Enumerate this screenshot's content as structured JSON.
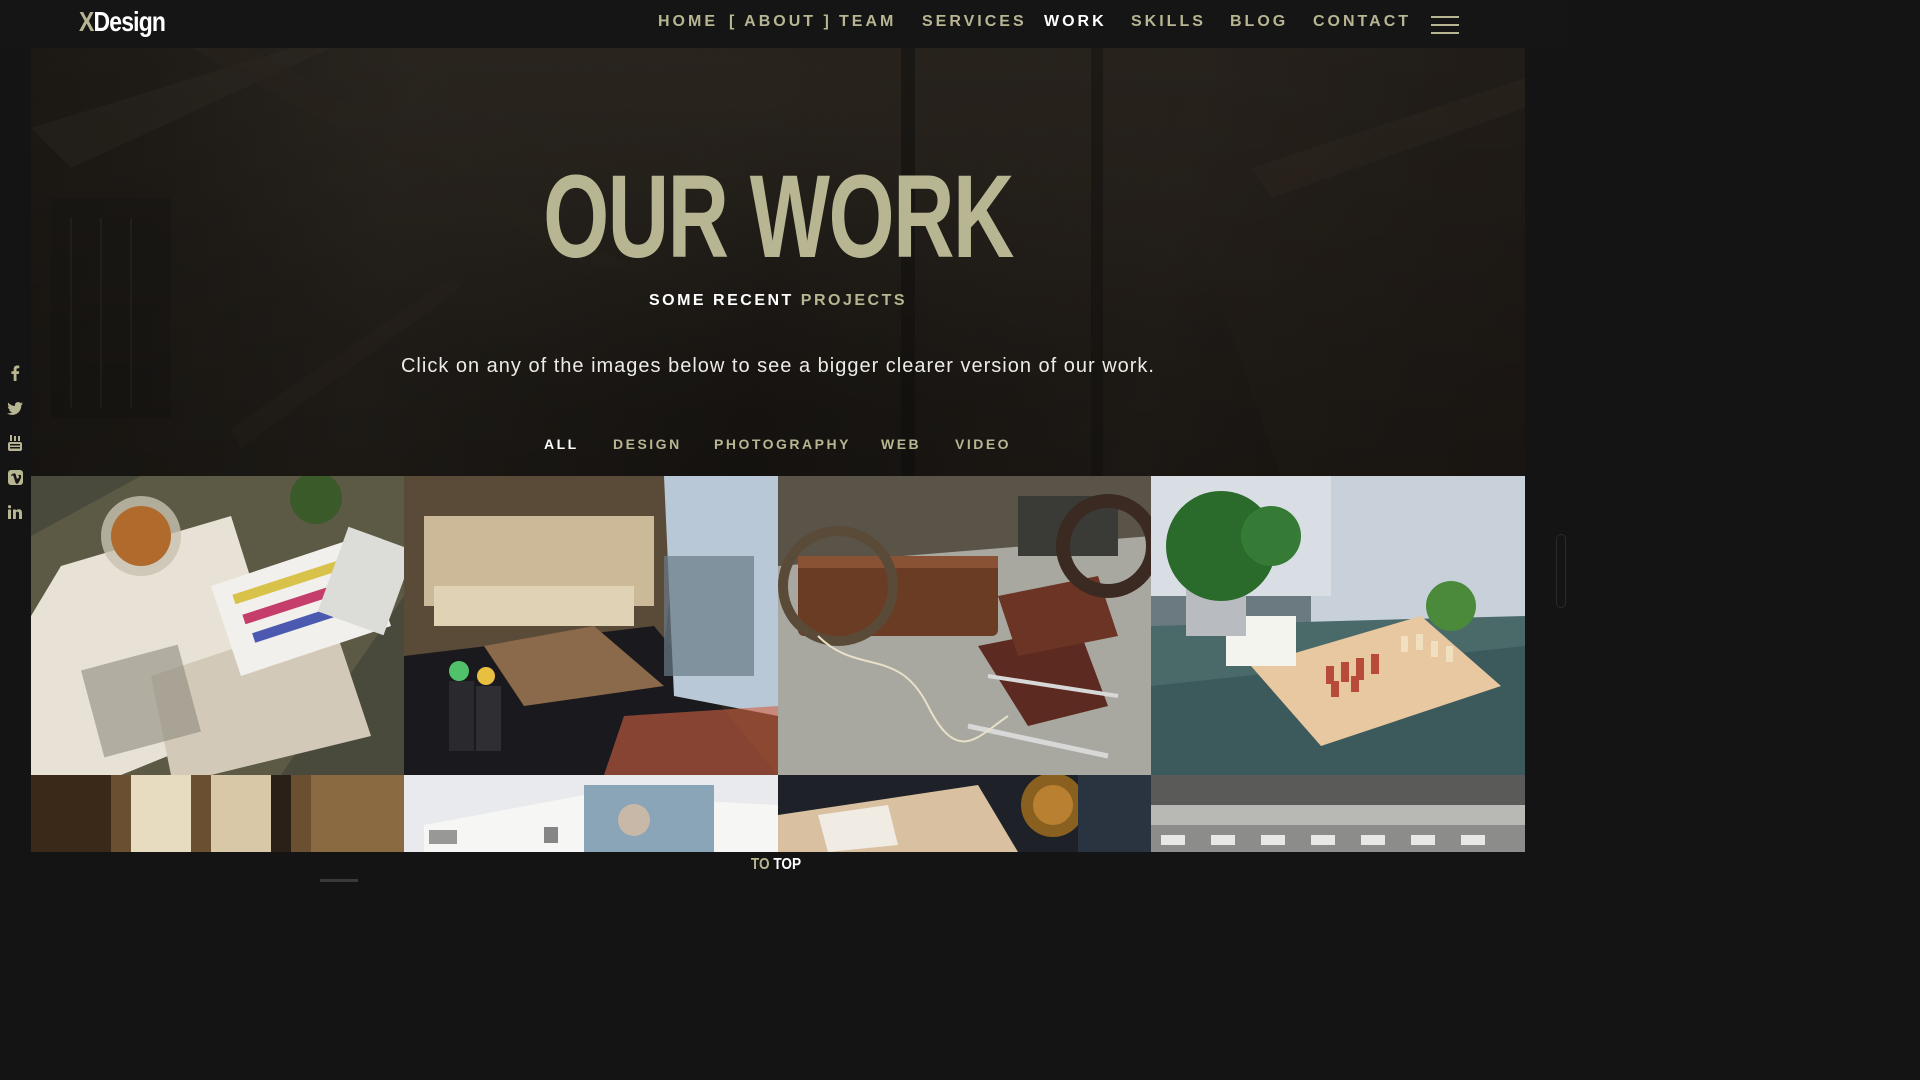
{
  "brand": {
    "logo_x": "X",
    "logo_rest": "Design"
  },
  "nav": {
    "items": [
      {
        "label": "HOME"
      },
      {
        "label": "[ ABOUT ]"
      },
      {
        "label": "TEAM"
      },
      {
        "label": "SERVICES"
      },
      {
        "label": "WORK"
      },
      {
        "label": "SKILLS"
      },
      {
        "label": "BLOG"
      },
      {
        "label": "CONTACT"
      }
    ],
    "active": "WORK",
    "menu_icon": "hamburger-icon"
  },
  "hero": {
    "title": "OUR WORK",
    "subtitle_a": "SOME RECENT",
    "subtitle_b": "PROJECTS",
    "description": "Click on any of the images below to see a bigger clearer version of our work."
  },
  "filters": {
    "items": [
      {
        "label": "ALL"
      },
      {
        "label": "DESIGN"
      },
      {
        "label": "PHOTOGRAPHY"
      },
      {
        "label": "WEB"
      },
      {
        "label": "VIDEO"
      }
    ],
    "active": "ALL"
  },
  "social": [
    "facebook-icon",
    "twitter-icon",
    "youtube-icon",
    "vimeo-icon",
    "linkedin-icon"
  ],
  "gallery": {
    "items": [
      {
        "subject": "desk with art supplies and tea"
      },
      {
        "subject": "building staircase in winter"
      },
      {
        "subject": "vintage suitcase and ice skates"
      },
      {
        "subject": "chess board with plants on wooden table"
      },
      {
        "subject": "building columns"
      },
      {
        "subject": "open magazine"
      },
      {
        "subject": "cheese board and drink"
      },
      {
        "subject": "sea waves and beach chairs"
      }
    ]
  },
  "footer": {
    "to": "TO",
    "top": "TOP"
  },
  "colors": {
    "accent": "#b8b592",
    "background": "#141414",
    "text": "#ffffff"
  }
}
